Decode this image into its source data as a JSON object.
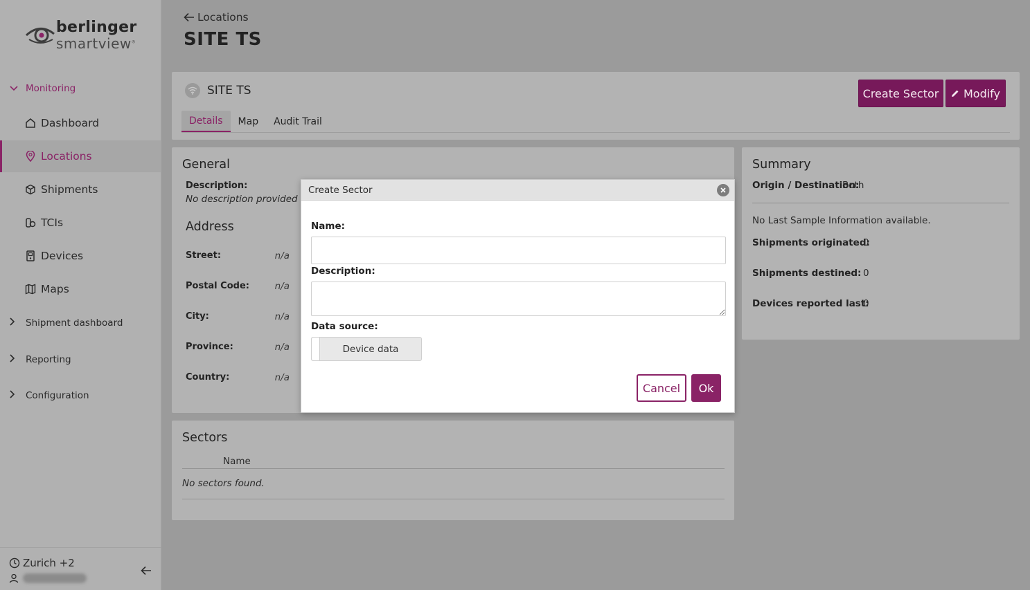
{
  "brand": {
    "name_line1": "berlinger",
    "name_line2": "smartview",
    "accent_color": "#8a2366"
  },
  "sidebar": {
    "monitoring_label": "Monitoring",
    "items": [
      {
        "label": "Dashboard",
        "icon": "home-icon"
      },
      {
        "label": "Locations",
        "icon": "location-pin-icon",
        "active": true
      },
      {
        "label": "Shipments",
        "icon": "box-icon"
      },
      {
        "label": "TCIs",
        "icon": "tci-icon"
      },
      {
        "label": "Devices",
        "icon": "device-icon"
      },
      {
        "label": "Maps",
        "icon": "map-icon"
      }
    ],
    "groups": [
      {
        "label": "Shipment dashboard"
      },
      {
        "label": "Reporting"
      },
      {
        "label": "Configuration"
      }
    ],
    "footer": {
      "timezone": "Zurich +2"
    }
  },
  "header": {
    "back_label": "Locations",
    "title": "SITE TS"
  },
  "site": {
    "name": "SITE TS",
    "create_sector_label": "Create Sector",
    "modify_label": "Modify",
    "tabs": [
      "Details",
      "Map",
      "Audit Trail"
    ]
  },
  "general": {
    "title": "General",
    "description_label": "Description:",
    "description_value": "No description provided",
    "address_title": "Address",
    "street_label": "Street:",
    "street_value": "n/a",
    "postal_label": "Postal Code:",
    "postal_value": "n/a",
    "city_label": "City:",
    "city_value": "n/a",
    "province_label": "Province:",
    "province_value": "n/a",
    "country_label": "Country:",
    "country_value": "n/a"
  },
  "summary": {
    "title": "Summary",
    "origin_label": "Origin / Destination:",
    "origin_value": "Both",
    "no_sample": "No Last Sample Information available.",
    "originated_label": "Shipments originated:",
    "originated_value": "0",
    "destined_label": "Shipments destined:",
    "destined_value": "0",
    "devices_label": "Devices reported last:",
    "devices_value": "0"
  },
  "sectors": {
    "title": "Sectors",
    "column_name": "Name",
    "empty": "No sectors found."
  },
  "modal": {
    "title": "Create Sector",
    "name_label": "Name:",
    "name_value": "",
    "description_label": "Description:",
    "description_value": "",
    "data_source_label": "Data source:",
    "data_source_value": "Device data",
    "cancel_label": "Cancel",
    "ok_label": "Ok"
  }
}
